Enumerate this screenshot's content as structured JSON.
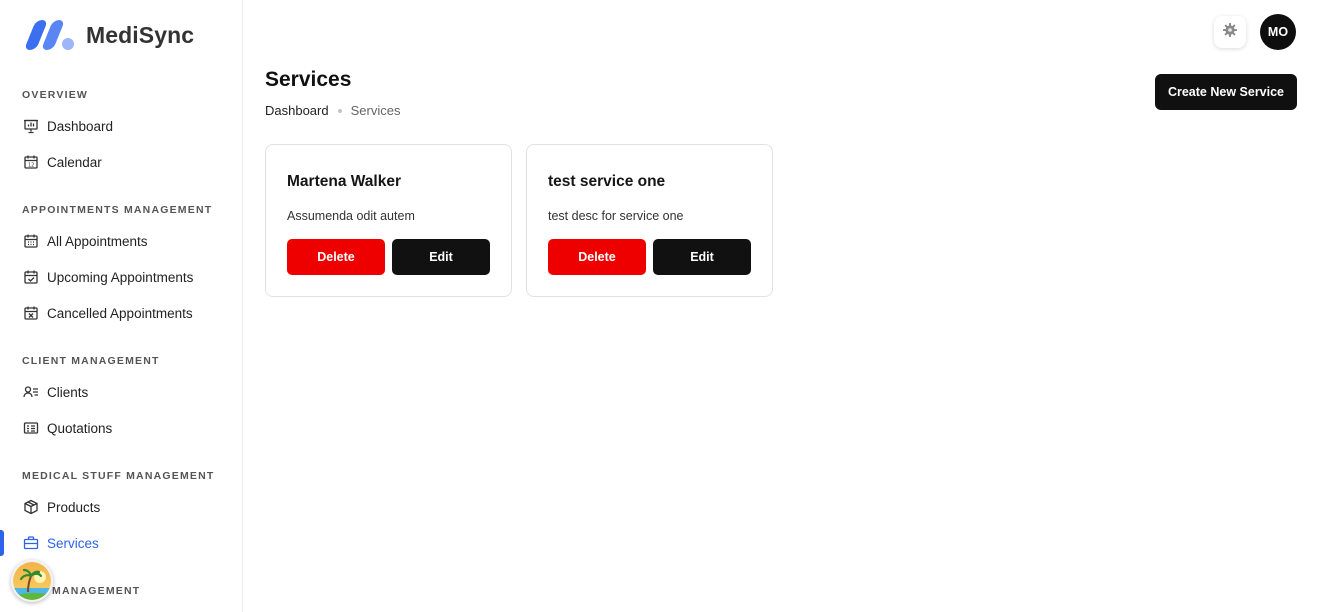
{
  "brand": {
    "name": "MediSync"
  },
  "header": {
    "settings_icon": "gear-icon",
    "user_initials": "MO"
  },
  "sidebar": {
    "sections": [
      {
        "title": "OVERVIEW"
      },
      {
        "title": "APPOINTMENTS MANAGEMENT"
      },
      {
        "title": "CLIENT MANAGEMENT"
      },
      {
        "title": "MEDICAL STUFF MANAGEMENT"
      },
      {
        "title": "MANAGEMENT"
      }
    ],
    "items": [
      {
        "label": "Dashboard",
        "icon": "presentation-chart-icon"
      },
      {
        "label": "Calendar",
        "icon": "calendar-icon"
      },
      {
        "label": "All Appointments",
        "icon": "calendar-grid-icon"
      },
      {
        "label": "Upcoming Appointments",
        "icon": "calendar-check-icon"
      },
      {
        "label": "Cancelled Appointments",
        "icon": "calendar-x-icon"
      },
      {
        "label": "Clients",
        "icon": "user-list-icon"
      },
      {
        "label": "Quotations",
        "icon": "invoice-icon"
      },
      {
        "label": "Products",
        "icon": "box-icon"
      },
      {
        "label": "Services",
        "icon": "briefcase-icon",
        "active": true
      }
    ]
  },
  "page": {
    "title": "Services",
    "breadcrumb": [
      "Dashboard",
      "Services"
    ],
    "create_button": "Create New Service"
  },
  "services": [
    {
      "title": "Martena Walker",
      "description": "Assumenda odit autem",
      "delete_label": "Delete",
      "edit_label": "Edit"
    },
    {
      "title": "test service one",
      "description": "test desc for service one",
      "delete_label": "Delete",
      "edit_label": "Edit"
    }
  ],
  "colors": {
    "accent": "#2c63e8",
    "danger": "#ee0000",
    "dark": "#111111"
  }
}
